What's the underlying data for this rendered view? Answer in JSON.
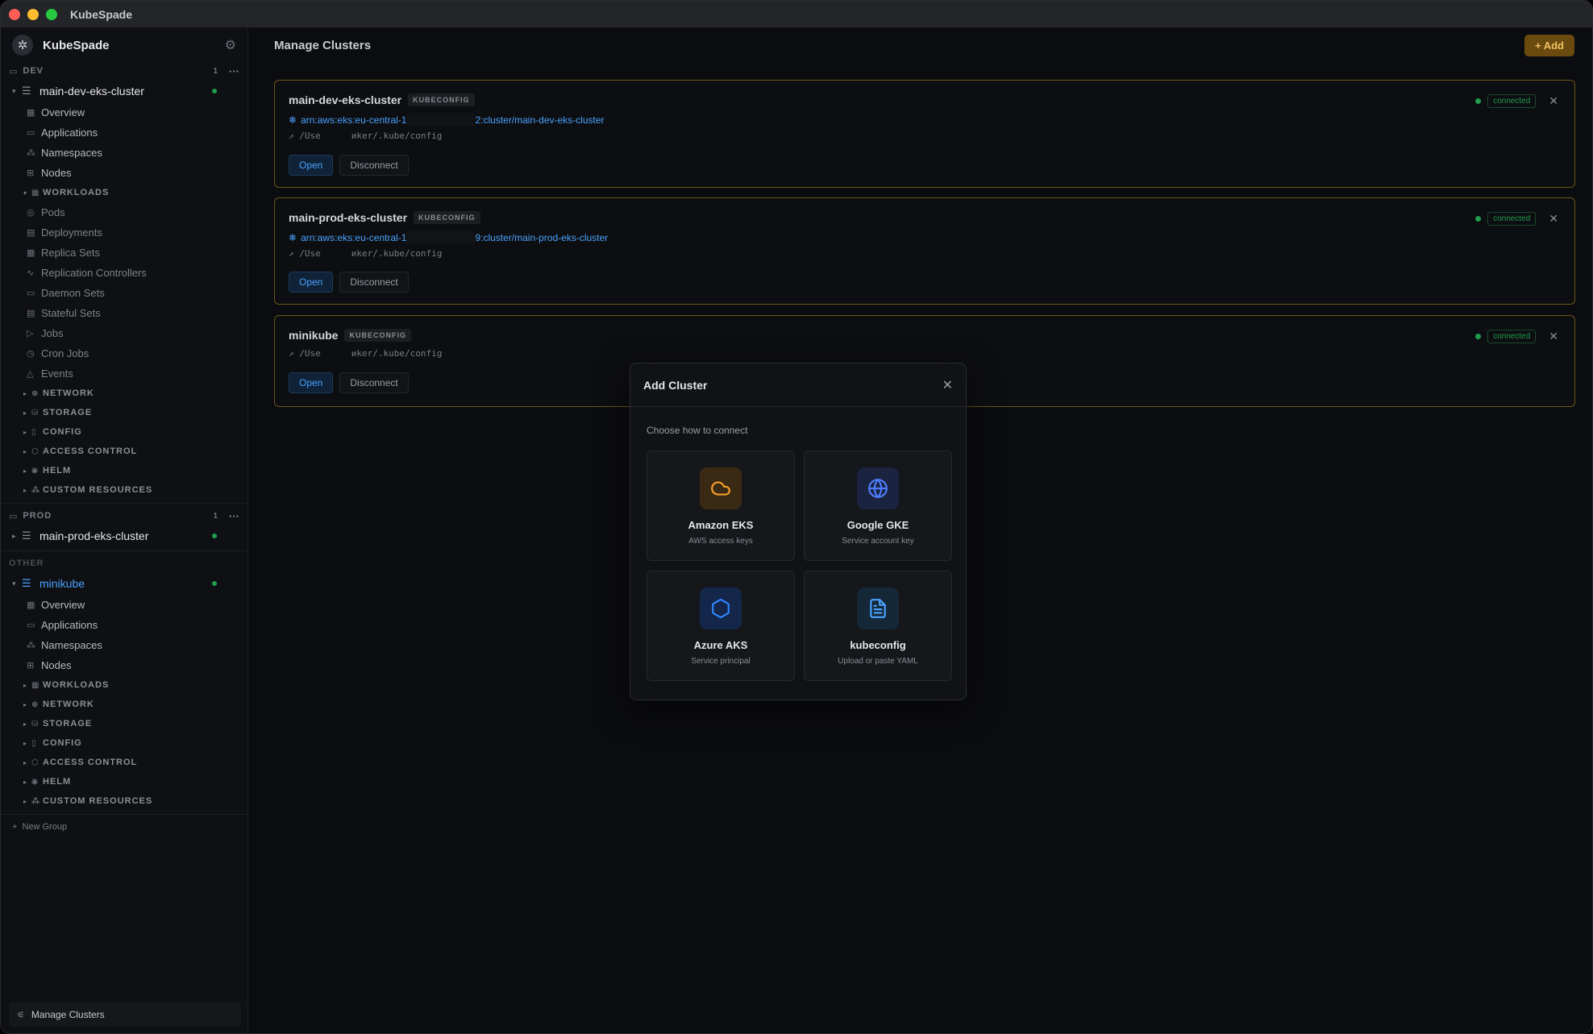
{
  "app": {
    "title": "KubeSpade"
  },
  "sidebar": {
    "brand": "KubeSpade",
    "groups": [
      {
        "name": "DEV",
        "count": "1"
      },
      {
        "name": "PROD",
        "count": "1"
      },
      {
        "name": "OTHER"
      }
    ],
    "clusters": {
      "dev": "main-dev-eks-cluster",
      "prod": "main-prod-eks-cluster",
      "other": "minikube"
    },
    "dev_items": [
      "Overview",
      "Applications",
      "Namespaces",
      "Nodes"
    ],
    "workloads_label": "WORKLOADS",
    "workload_items": [
      "Pods",
      "Deployments",
      "Replica Sets",
      "Replication Controllers",
      "Daemon Sets",
      "Stateful Sets",
      "Jobs",
      "Cron Jobs",
      "Events"
    ],
    "sections": [
      "NETWORK",
      "STORAGE",
      "CONFIG",
      "ACCESS CONTROL",
      "HELM",
      "CUSTOM RESOURCES"
    ],
    "other_items": [
      "Overview",
      "Applications",
      "Namespaces",
      "Nodes"
    ],
    "new_group": "New Group",
    "footer": "Manage Clusters"
  },
  "main": {
    "title": "Manage Clusters",
    "add_button": "+ Add",
    "cards": [
      {
        "name": "main-dev-eks-cluster",
        "badge": "KUBECONFIG",
        "arn_prefix": "arn:aws:eks:eu-central-1",
        "arn_suffix": "2:cluster/main-dev-eks-cluster",
        "path_prefix": "/Usе",
        "path_suffix": "иker/.kube/config",
        "open": "Open",
        "disconnect": "Disconnect",
        "status": "connected"
      },
      {
        "name": "main-prod-eks-cluster",
        "badge": "KUBECONFIG",
        "arn_prefix": "arn:aws:eks:eu-central-1",
        "arn_suffix": "9:cluster/main-prod-eks-cluster",
        "path_prefix": "/Usе",
        "path_suffix": "иker/.kube/config",
        "open": "Open",
        "disconnect": "Disconnect",
        "status": "connected"
      },
      {
        "name": "minikube",
        "badge": "KUBECONFIG",
        "path_prefix": "/Usе",
        "path_suffix": "иker/.kube/config",
        "open": "Open",
        "disconnect": "Disconnect",
        "status": "connected"
      }
    ]
  },
  "modal": {
    "title": "Add Cluster",
    "subtitle": "Choose how to connect",
    "options": [
      {
        "name": "Amazon EKS",
        "desc": "AWS access keys",
        "icon": "cloud-icon",
        "color": "#f59e2b"
      },
      {
        "name": "Google GKE",
        "desc": "Service account key",
        "icon": "globe-icon",
        "color": "#4f7dff"
      },
      {
        "name": "Azure AKS",
        "desc": "Service principal",
        "icon": "hexagon-icon",
        "color": "#2f86ff"
      },
      {
        "name": "kubeconfig",
        "desc": "Upload or paste YAML",
        "icon": "file-icon",
        "color": "#4aa3ff"
      }
    ]
  }
}
